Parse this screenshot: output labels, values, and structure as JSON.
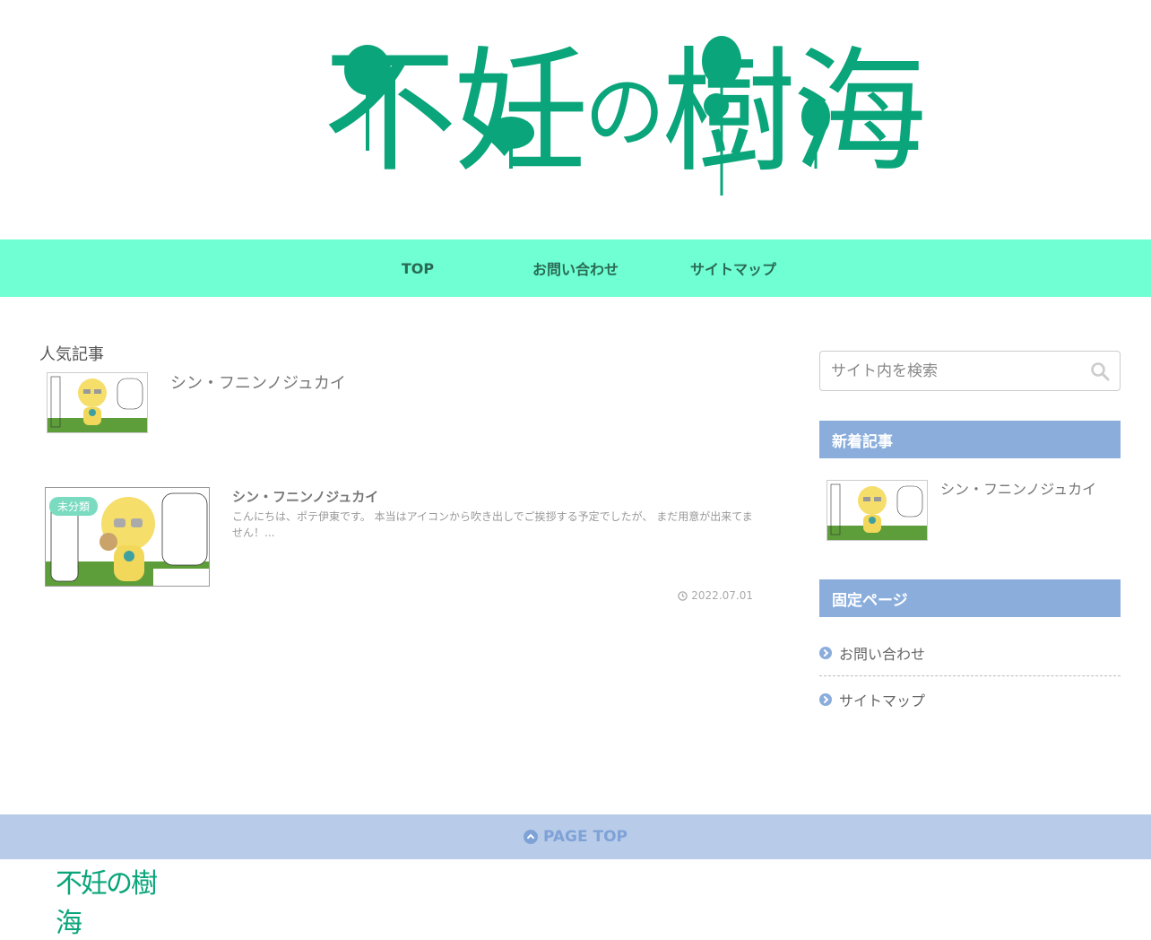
{
  "header": {
    "logo_text": "不妊の樹海",
    "logo_chars": [
      "不",
      "妊",
      "の",
      "樹",
      "海"
    ],
    "brand_color": "#0aa57a"
  },
  "nav": {
    "items": [
      {
        "label": "TOP"
      },
      {
        "label": "お問い合わせ"
      },
      {
        "label": "サイトマップ"
      }
    ],
    "bg_color": "#6fffd2"
  },
  "main": {
    "popular_title": "人気記事",
    "popular_items": [
      {
        "title": "シン・フニンノジュカイ"
      }
    ],
    "cards": [
      {
        "category": "未分類",
        "title": "シン・フニンノジュカイ",
        "snippet": "こんにちは、ポテ伊東です。 本当はアイコンから吹き出しでご挨拶する予定でしたが、 まだ用意が出来てません！...",
        "date": "2022.07.01"
      }
    ]
  },
  "sidebar": {
    "search_placeholder": "サイト内を検索",
    "new_posts_title": "新着記事",
    "new_posts": [
      {
        "title": "シン・フニンノジュカイ"
      }
    ],
    "fixed_pages_title": "固定ページ",
    "fixed_pages": [
      {
        "label": "お問い合わせ"
      },
      {
        "label": "サイトマップ"
      }
    ],
    "accent_color": "#8aaddc"
  },
  "footer": {
    "page_top_label": "PAGE TOP",
    "logo_text": "不妊の樹海"
  }
}
